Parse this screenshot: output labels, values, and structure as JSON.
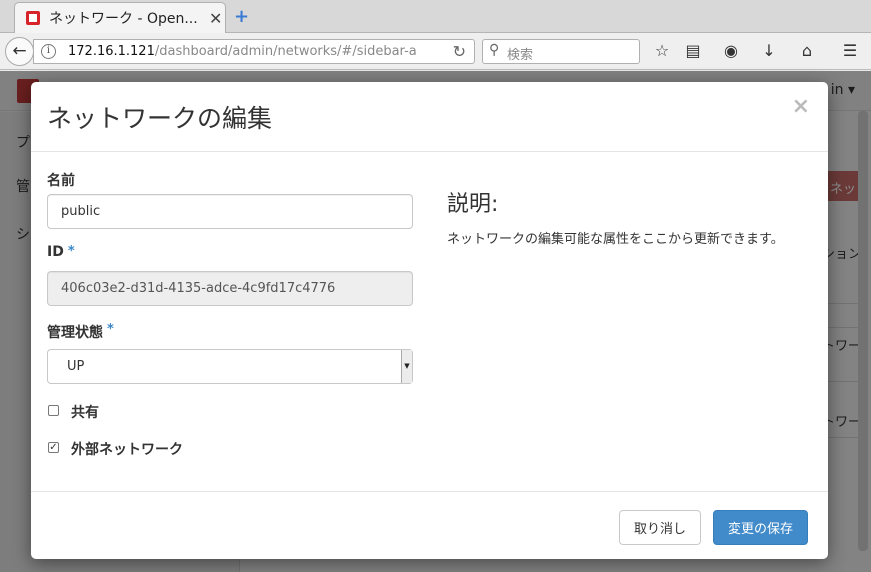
{
  "browser": {
    "tab_title": "ネットワーク - Open...",
    "tab_close": "✕",
    "new_tab": "+",
    "url_host": "172.16.1.121",
    "url_path": "/dashboard/admin/networks/#/sidebar-a",
    "search_placeholder": "検索"
  },
  "background": {
    "user_menu": "in ▾",
    "sidebar_items": [
      "プ",
      "管",
      "シ"
    ],
    "red_button": "ネッ",
    "table_header": "ション",
    "row_cells": [
      "トワー",
      "トワー"
    ]
  },
  "modal": {
    "title": "ネットワークの編集",
    "close": "×",
    "name_label": "名前",
    "name_value": "public",
    "id_label": "ID",
    "id_value": "406c03e2-d31d-4135-adce-4c9fd17c4776",
    "admin_state_label": "管理状態",
    "admin_state_value": "UP",
    "required_mark": "*",
    "shared_label": "共有",
    "shared_checked": false,
    "external_label": "外部ネットワーク",
    "external_checked": true,
    "help_title": "説明:",
    "help_text": "ネットワークの編集可能な属性をここから更新できます。",
    "cancel_button": "取り消し",
    "save_button": "変更の保存"
  },
  "colors": {
    "primary": "#428bca",
    "required": "#3a87c8",
    "brand_red": "#d6242a"
  }
}
